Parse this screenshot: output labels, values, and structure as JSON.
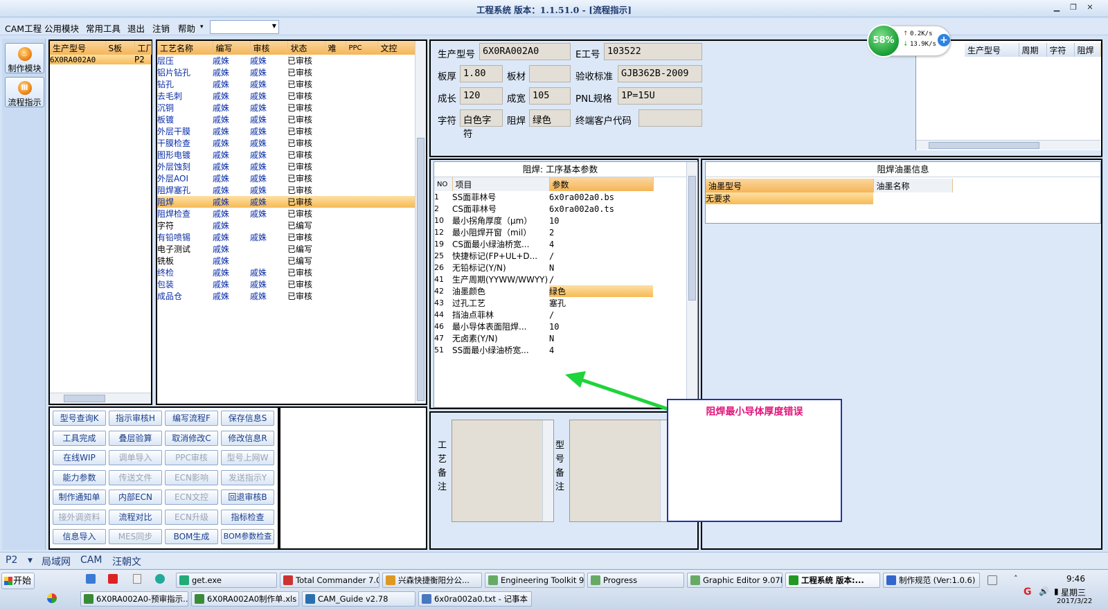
{
  "title": {
    "text": "工程系统  版本：1.1.51.0 - [流程指示]"
  },
  "menu": {
    "items": [
      "CAM工程",
      "公用模块",
      "常用工具",
      "退出",
      "注销",
      "帮助"
    ],
    "combo_arrow": "▾"
  },
  "leftnav": {
    "items": [
      "制作模块",
      "流程指示"
    ]
  },
  "model_list": {
    "headers": [
      "生产型号",
      "S板",
      "工厂"
    ],
    "rows": [
      [
        "6X0RA002A0",
        "",
        "P2"
      ]
    ]
  },
  "process_list": {
    "headers": [
      "工艺名称",
      "编写",
      "审核",
      "状态",
      "难",
      "PPC",
      "文控"
    ],
    "selected_index": 12,
    "rows": [
      [
        "层压",
        "戚姝",
        "戚姝",
        "已审核"
      ],
      [
        "铝片钻孔",
        "戚姝",
        "戚姝",
        "已审核"
      ],
      [
        "钻孔",
        "戚姝",
        "戚姝",
        "已审核"
      ],
      [
        "去毛刺",
        "戚姝",
        "戚姝",
        "已审核"
      ],
      [
        "沉铜",
        "戚姝",
        "戚姝",
        "已审核"
      ],
      [
        "板镀",
        "戚姝",
        "戚姝",
        "已审核"
      ],
      [
        "外层干膜",
        "戚姝",
        "戚姝",
        "已审核"
      ],
      [
        "干膜检查",
        "戚姝",
        "戚姝",
        "已审核"
      ],
      [
        "图形电镀",
        "戚姝",
        "戚姝",
        "已审核"
      ],
      [
        "外层蚀刻",
        "戚姝",
        "戚姝",
        "已审核"
      ],
      [
        "外层AOI",
        "戚姝",
        "戚姝",
        "已审核"
      ],
      [
        "阻焊塞孔",
        "戚姝",
        "戚姝",
        "已审核"
      ],
      [
        "阻焊",
        "戚姝",
        "戚姝",
        "已审核"
      ],
      [
        "阻焊检查",
        "戚姝",
        "戚姝",
        "已审核"
      ],
      [
        "字符",
        "戚姝",
        "",
        "已编写"
      ],
      [
        "有铅喷锡",
        "戚姝",
        "戚姝",
        "已审核"
      ],
      [
        "电子测试",
        "戚姝",
        "",
        "已编写"
      ],
      [
        "铣板",
        "戚姝",
        "",
        "已编写"
      ],
      [
        "终检",
        "戚姝",
        "戚姝",
        "已审核"
      ],
      [
        "包装",
        "戚姝",
        "戚姝",
        "已审核"
      ],
      [
        "成品仓",
        "戚姝",
        "戚姝",
        "已审核"
      ]
    ]
  },
  "buttons": [
    "型号查询K",
    "指示审核H",
    "编写流程F",
    "保存信息S",
    "工具完成",
    "叠层验算",
    "取消修改C",
    "修改信息R",
    "在线WIP",
    "调单导入",
    "PPC审核",
    "型号上网W",
    "能力参数",
    "传送文件",
    "ECN影响",
    "发送指示Y",
    "制作通知单",
    "内部ECN",
    "ECN文控",
    "回退审核B",
    "接外调资料",
    "流程对比",
    "ECN升级",
    "指标检查",
    "信息导入",
    "MES同步",
    "BOM生成",
    "BOM参数检查"
  ],
  "buttons_disabled": [
    9,
    10,
    11,
    13,
    14,
    15,
    18,
    20,
    22,
    25
  ],
  "info": {
    "production_model_label": "生产型号",
    "production_model": "6X0RA002A0",
    "e_engineer_label": "E工号",
    "e_engineer": "103522",
    "thickness_label": "板厚",
    "thickness": "1.80",
    "material_label": "板材",
    "material": "",
    "acceptance_std_label": "验收标准",
    "acceptance_std": "GJB362B-2009",
    "length_label": "成长",
    "length": "120",
    "width_label": "成宽",
    "width": "105",
    "pnl_spec_label": "PNL规格",
    "pnl_spec": "1P=15U",
    "char_label": "字符",
    "char": "白色字符",
    "solder_mask_label": "阻焊",
    "solder_mask": "绿色",
    "end_customer_label": "终端客户代码",
    "end_customer": ""
  },
  "mini_grid": {
    "headers": [
      "生产型号",
      "周期",
      "字符",
      "阻焊"
    ]
  },
  "params": {
    "title": "阻焊: 工序基本参数",
    "headers": [
      "NO",
      "项目",
      "参数"
    ],
    "highlight_index": 9,
    "rows": [
      [
        "1",
        "SS面菲林号",
        "6x0ra002a0.bs"
      ],
      [
        "2",
        "CS面菲林号",
        "6x0ra002a0.ts"
      ],
      [
        "10",
        "最小拐角厚度（μm）",
        "10"
      ],
      [
        "12",
        "最小阻焊开窗（mil）",
        "2"
      ],
      [
        "19",
        "CS面最小绿油桥宽...",
        "4"
      ],
      [
        "25",
        "快捷标记(FP+UL+D...",
        "/"
      ],
      [
        "26",
        "无铅标记(Y/N)",
        "N"
      ],
      [
        "41",
        "生产周期(YYWW/WWYY)",
        "/"
      ],
      [
        "42",
        "油墨颜色",
        "绿色"
      ],
      [
        "43",
        "过孔工艺",
        "塞孔"
      ],
      [
        "44",
        "挡油点菲林",
        "/"
      ],
      [
        "46",
        "最小导体表面阻焊...",
        "10"
      ],
      [
        "47",
        "无卤素(Y/N)",
        "N"
      ],
      [
        "51",
        "SS面最小绿油桥宽...",
        "4"
      ]
    ]
  },
  "ink": {
    "title": "阻焊油墨信息",
    "headers": [
      "油墨型号",
      "油墨名称"
    ],
    "rows": [
      [
        "无要求",
        ""
      ]
    ]
  },
  "notes": {
    "process_label": "工艺备注",
    "model_label": "型号备注"
  },
  "annotation": {
    "text": "阻焊最小导体厚度错误",
    "arrow_color": "#1ed43a"
  },
  "statusbar": {
    "items": [
      "P2",
      "局域网",
      "CAM",
      "汪朝文"
    ]
  },
  "network": {
    "percent": "58%",
    "up": "0.2K/s",
    "down": "13.9K/s"
  },
  "taskbar": {
    "start": "开始",
    "row1": [
      "get.exe",
      "Total Commander 7.0...",
      "兴森快捷衡阳分公...",
      "Engineering Toolkit 9....",
      "Progress",
      "Graphic Editor 9.07b2...",
      "工程系统  版本:...",
      "制作规范 (Ver:1.0.6)"
    ],
    "row2": [
      "6X0RA002A0-预审指示....",
      "6X0RA002A0制作单.xls ...",
      "CAM_Guide v2.78",
      "6x0ra002a0.txt - 记事本"
    ],
    "clock": "9:46",
    "weekday": "星期三",
    "date": "2017/3/22"
  }
}
